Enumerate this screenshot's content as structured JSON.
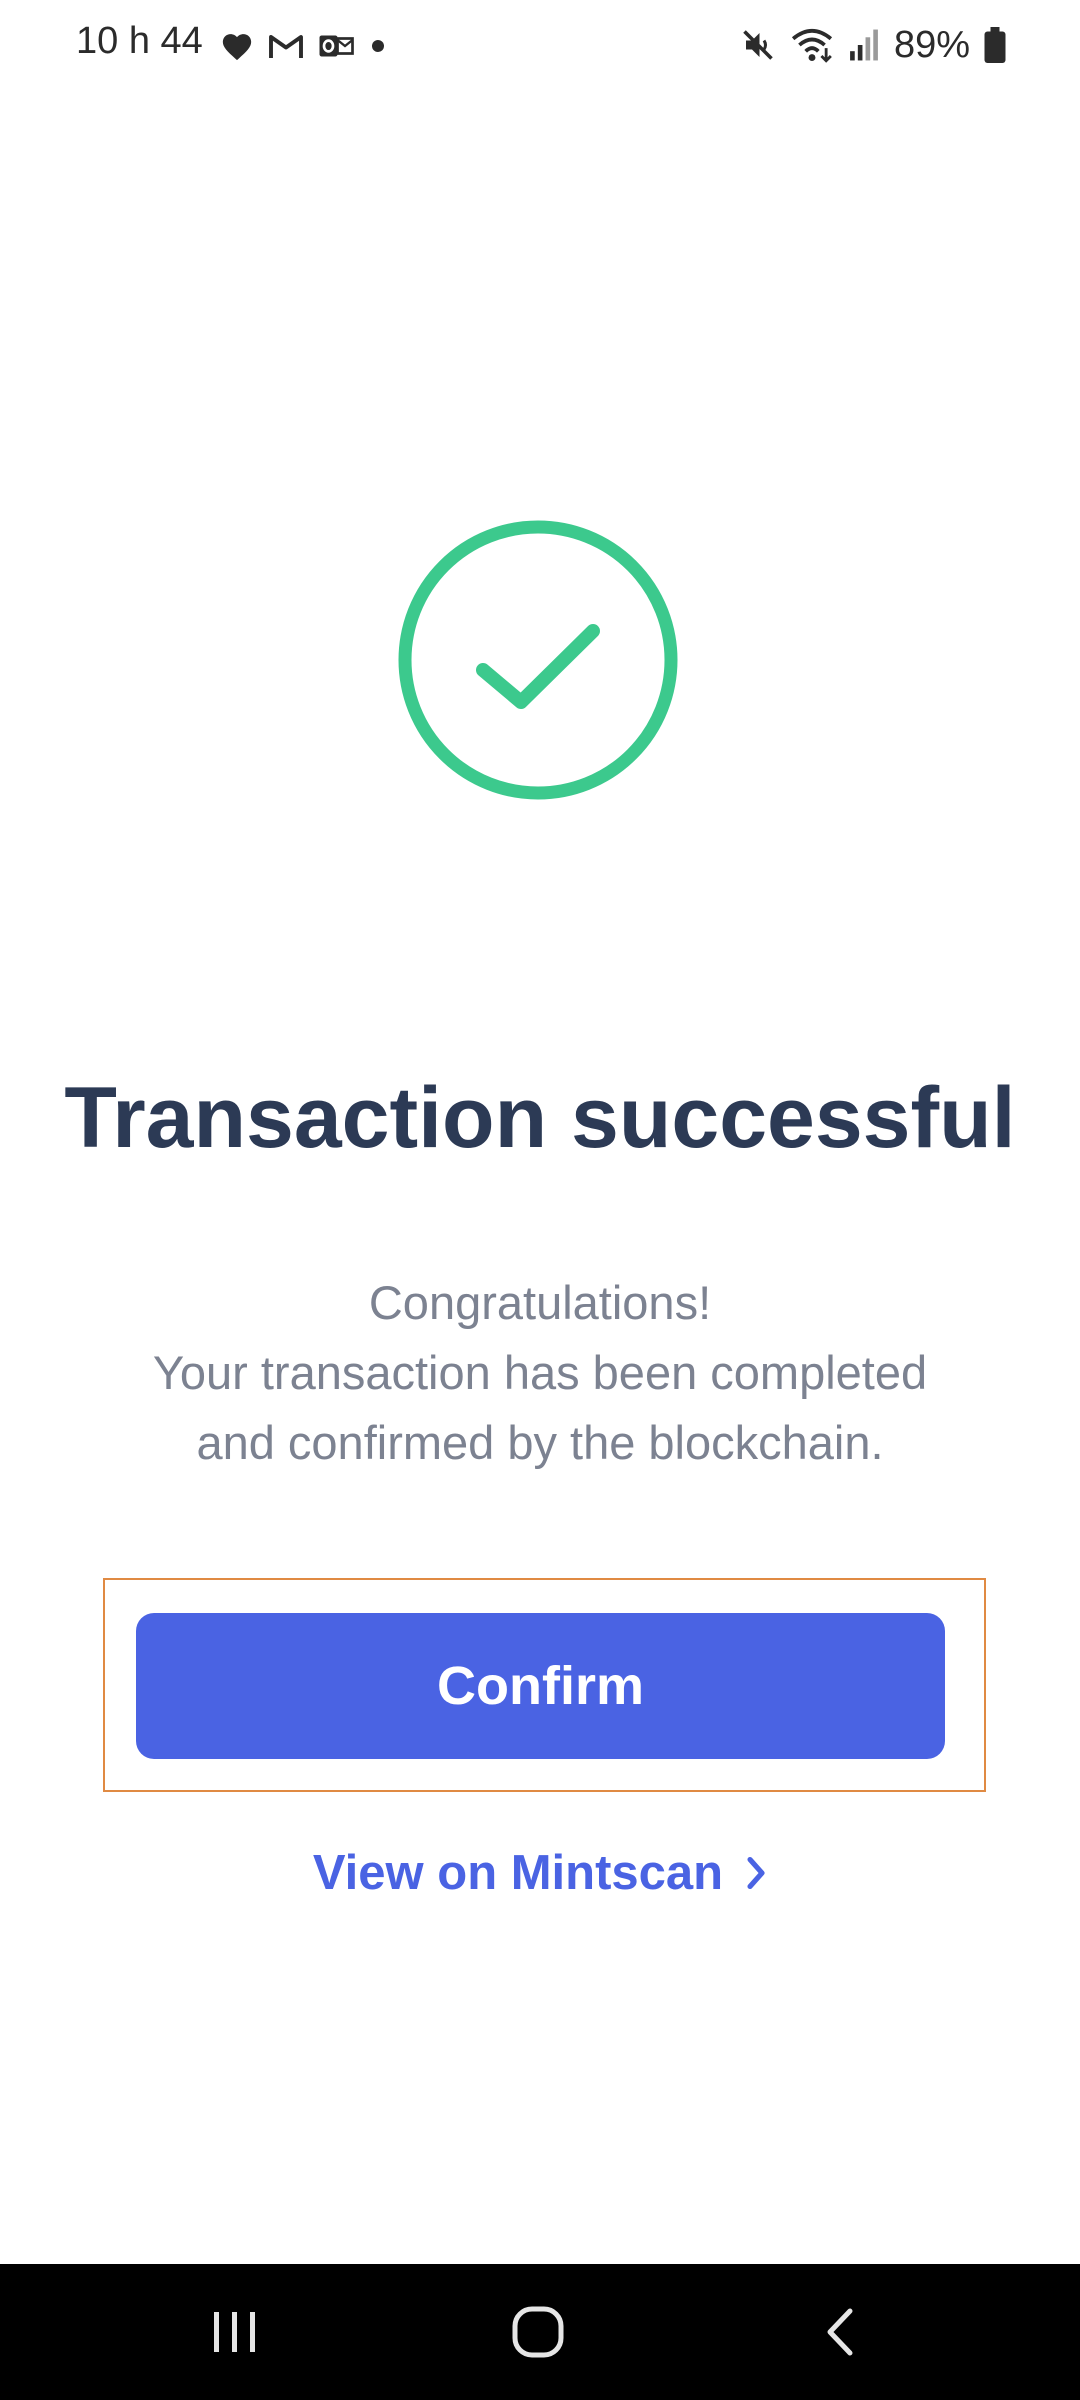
{
  "status_bar": {
    "time": "10 h 44",
    "battery": "89%",
    "left_icons": [
      "heart-icon",
      "gmail-icon",
      "outlook-icon",
      "dot-icon"
    ],
    "right_icons": [
      "mute-icon",
      "wifi-icon",
      "signal-icon",
      "battery-icon"
    ]
  },
  "success": {
    "icon": "check-circle-icon",
    "color": "#3cc98d"
  },
  "content": {
    "title": "Transaction successful",
    "message_lines": [
      "Congratulations!",
      "Your transaction has been completed",
      "and confirmed by the blockchain."
    ]
  },
  "actions": {
    "confirm_label": "Confirm",
    "confirm_color": "#4a63e3",
    "view_link_label": "View on Mintscan",
    "view_link_icon": "chevron-right-icon"
  },
  "nav_bar": {
    "items": [
      "recent-apps-icon",
      "home-icon",
      "back-icon"
    ]
  }
}
